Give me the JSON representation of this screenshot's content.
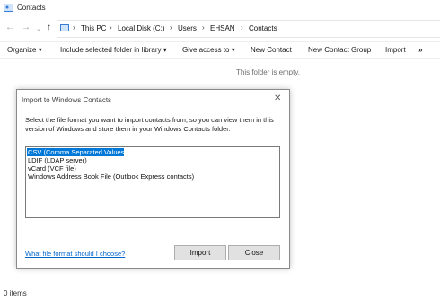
{
  "window": {
    "title": "Contacts"
  },
  "nav": {
    "breadcrumb": [
      "This PC",
      "Local Disk (C:)",
      "Users",
      "EHSAN",
      "Contacts"
    ]
  },
  "toolbar": {
    "organize": "Organize",
    "include_library": "Include selected folder in library",
    "give_access": "Give access to",
    "new_contact": "New Contact",
    "new_contact_group": "New Contact Group",
    "import": "Import",
    "more": "»"
  },
  "content": {
    "empty_message": "This folder is empty."
  },
  "dialog": {
    "title": "Import to Windows Contacts",
    "instruction": "Select the file format you want to import contacts from, so you can view them in this version of Windows and store them in your Windows Contacts folder.",
    "formats": [
      "CSV (Comma Separated Values)",
      "LDIF (LDAP server)",
      "vCard (VCF file)",
      "Windows Address Book File (Outlook Express contacts)"
    ],
    "selected_index": 0,
    "help_link": "What file format should I choose?",
    "import_label": "Import",
    "close_label": "Close"
  },
  "status": {
    "items": "0 items"
  },
  "colors": {
    "selection": "#0078d7",
    "link": "#0066cc"
  }
}
